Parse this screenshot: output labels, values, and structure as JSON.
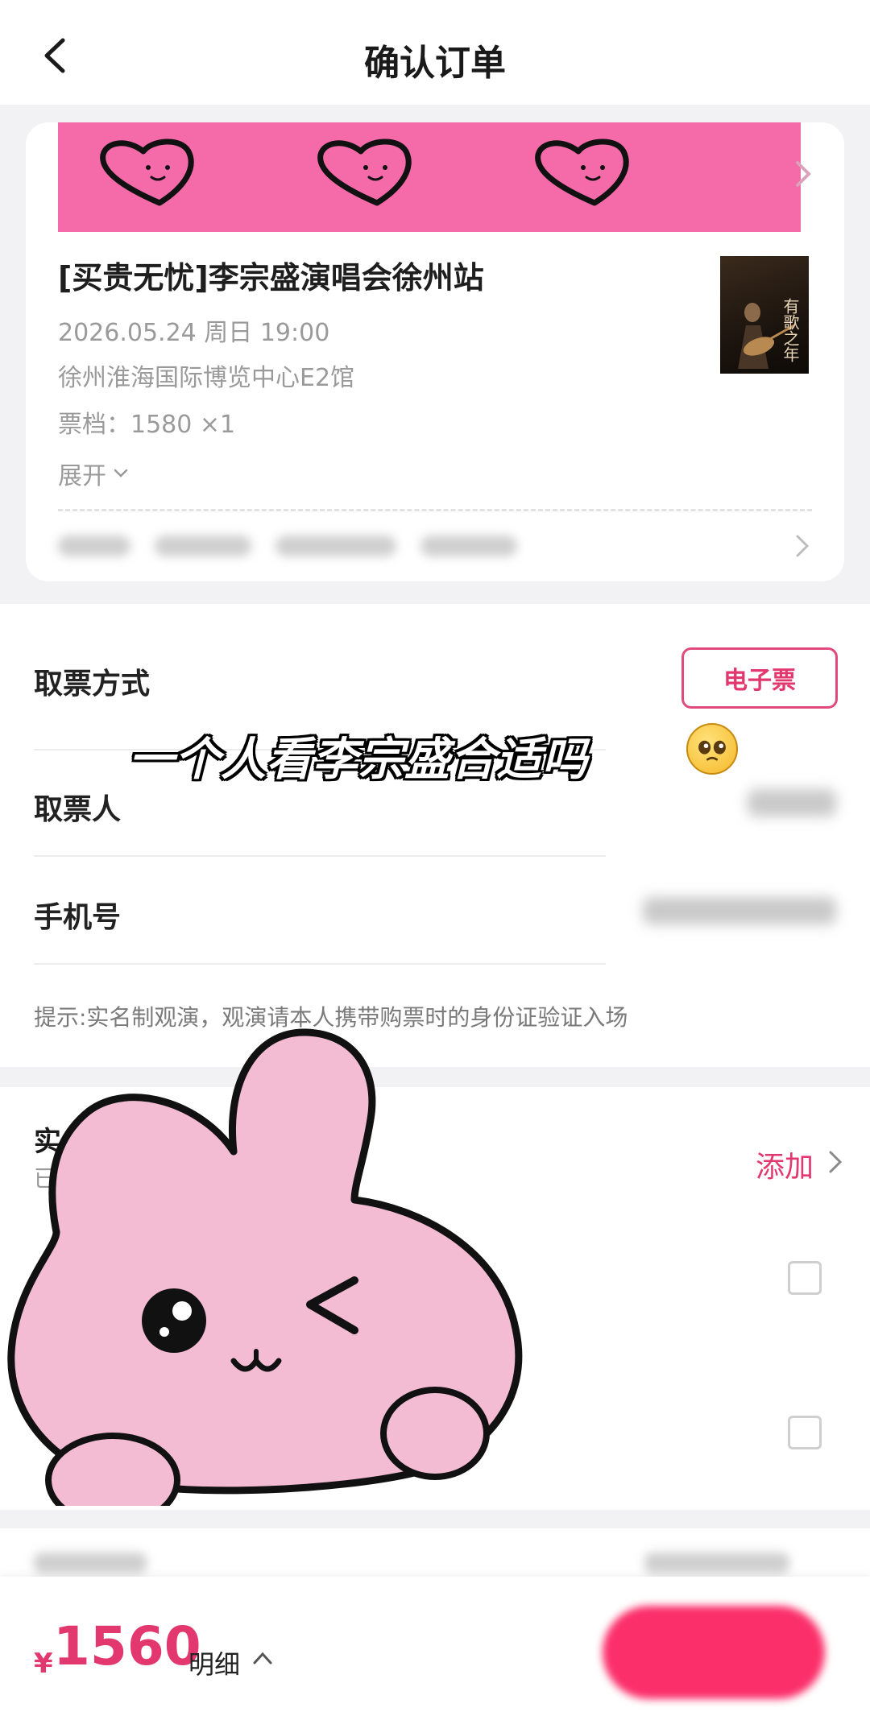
{
  "header": {
    "title": "确认订单"
  },
  "event": {
    "title": "[买贵无忧]李宗盛演唱会徐州站",
    "datetime": "2026.05.24 周日 19:00",
    "venue": "徐州淮海国际博览中心E2馆",
    "ticket_tier": "票档：1580  ×1",
    "expand_label": "展开",
    "poster_text": "有歌之年"
  },
  "delivery": {
    "label": "取票方式",
    "option_label": "电子票"
  },
  "form": {
    "recipient_label": "取票人",
    "phone_label": "手机号",
    "hint": "提示:实名制观演，观演请本人携带购票时的身份证验证入场"
  },
  "realname": {
    "title_partial": "实",
    "subtitle_partial": "已",
    "add_label": "添加"
  },
  "overlay": {
    "caption": "一个人看李宗盛合适吗"
  },
  "bottom": {
    "currency": "¥",
    "total": "1560",
    "detail_label": "明细"
  },
  "colors": {
    "accent": "#e2376f",
    "banner_pink": "#f56aa8",
    "mascot_pink": "#f3bcd3"
  }
}
